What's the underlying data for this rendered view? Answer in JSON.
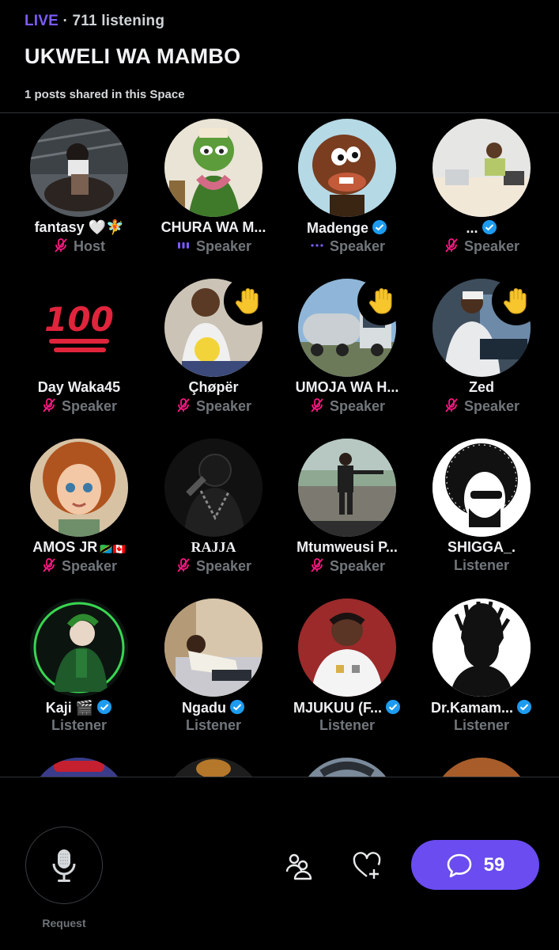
{
  "header": {
    "live_label": "LIVE",
    "listening_text": "· 711 listening",
    "title": "UKWELI WA MAMBO",
    "posts_text": "1 posts shared in this Space"
  },
  "participants": [
    {
      "name": "fantasy 🤍🧚",
      "role": "Host",
      "verified": false,
      "muted": true,
      "hand_raised": false
    },
    {
      "name": "CHURA WA M...",
      "role": "Speaker",
      "verified": false,
      "muted": false,
      "speaking": true,
      "hand_raised": false
    },
    {
      "name": "Madenge",
      "role": "Speaker",
      "verified": true,
      "muted": false,
      "speaking": false,
      "hand_raised": false
    },
    {
      "name": "...",
      "role": "Speaker",
      "verified": true,
      "muted": true,
      "hand_raised": false
    },
    {
      "name": "Day Waka45",
      "role": "Speaker",
      "verified": false,
      "muted": true,
      "hand_raised": false
    },
    {
      "name": "Çhøpër",
      "role": "Speaker",
      "verified": false,
      "muted": true,
      "hand_raised": true
    },
    {
      "name": "UMOJA WA H...",
      "role": "Speaker",
      "verified": false,
      "muted": true,
      "hand_raised": true
    },
    {
      "name": "Zed",
      "role": "Speaker",
      "verified": false,
      "muted": true,
      "hand_raised": true
    },
    {
      "name": "AMOS JR",
      "flags": "🇹🇿🇨🇦",
      "role": "Speaker",
      "verified": false,
      "muted": true,
      "hand_raised": false
    },
    {
      "name": "RAJJA",
      "role": "Speaker",
      "verified": false,
      "muted": true,
      "hand_raised": false
    },
    {
      "name": "Mtumweusi P...",
      "role": "Speaker",
      "verified": false,
      "muted": true,
      "hand_raised": false
    },
    {
      "name": "SHIGGA_.",
      "role": "Listener",
      "verified": false,
      "hand_raised": false
    },
    {
      "name": "Kaji 🎬",
      "role": "Listener",
      "verified": true,
      "hand_raised": false
    },
    {
      "name": "Ngadu",
      "role": "Listener",
      "verified": true,
      "hand_raised": false
    },
    {
      "name": "MJUKUU (F...",
      "role": "Listener",
      "verified": true,
      "hand_raised": false
    },
    {
      "name": "Dr.Kamam...",
      "role": "Listener",
      "verified": true,
      "hand_raised": false
    }
  ],
  "footer": {
    "request_label": "Request",
    "comment_count": "59"
  },
  "colors": {
    "accent": "#6a4cf0",
    "live": "#7d5cff",
    "verified": "#1d9bf0",
    "muted_icon": "#f91880",
    "role_text": "#71767b"
  },
  "icons": {
    "mic": "microphone-icon",
    "people": "people-icon",
    "heart": "heart-plus-icon",
    "chat": "chat-bubble-icon",
    "hand": "raised-hand-icon"
  }
}
